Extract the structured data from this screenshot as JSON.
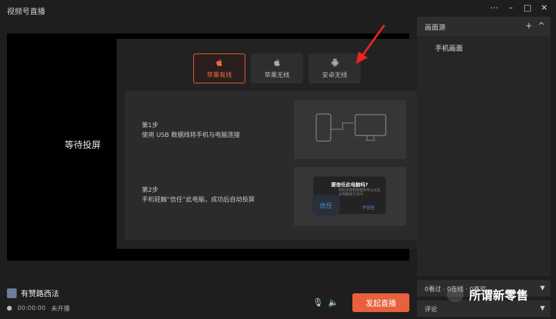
{
  "window": {
    "title": "视频号直播",
    "controls": [
      "⋯",
      "–",
      "□",
      "✕"
    ]
  },
  "preview": {
    "waiting_text": "等待投屏"
  },
  "modal": {
    "close": "×",
    "tabs": [
      {
        "label": "苹果有线",
        "icon": "apple-icon",
        "active": true
      },
      {
        "label": "苹果无线",
        "icon": "apple-icon",
        "active": false
      },
      {
        "label": "安卓无线",
        "icon": "android-icon",
        "active": false
      }
    ],
    "step1": {
      "title": "第1步",
      "desc": "使用 USB 数据线将手机与电脑连接"
    },
    "step2": {
      "title": "第2步",
      "desc": "手机轻触“信任”此电脑，成功后自动投屏"
    },
    "trust_dialog": {
      "title": "要信任此电脑吗?",
      "desc": "你的设置和数据将可以从这台电脑进行访问",
      "btn": "不信任",
      "trust_label": "信任"
    }
  },
  "sidebar": {
    "header": "画面源",
    "add": "+",
    "collapse": "^",
    "source_item": "手机画面",
    "stats": "0看过 · 0在线 · 0喜欢",
    "comments": "评论"
  },
  "footer": {
    "host_name": "有赞路西法",
    "timer": "00:00:00",
    "status": "未开播",
    "start_button": "发起直播"
  },
  "watermark": {
    "text": "所谓新零售"
  },
  "colors": {
    "accent": "#e8603c",
    "arrow": "#e8251f"
  }
}
